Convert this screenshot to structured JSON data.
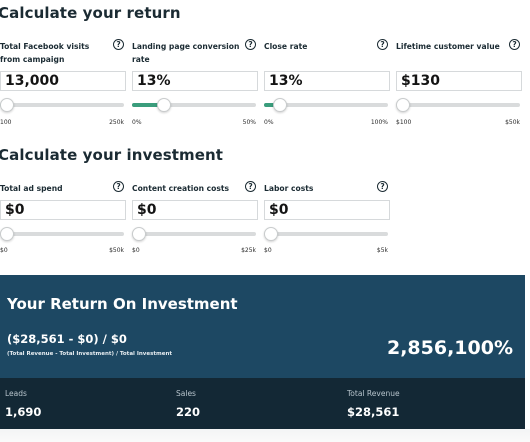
{
  "return_section": {
    "title": "Calculate your return",
    "fields": [
      {
        "label": "Total Facebook visits from campaign",
        "value": "13,000",
        "min": "100",
        "max": "250k",
        "level": 0.05
      },
      {
        "label": "Landing page conversion rate",
        "value": "13%",
        "min": "0%",
        "max": "50%",
        "level": 0.26
      },
      {
        "label": "Close rate",
        "value": "13%",
        "min": "0%",
        "max": "100%",
        "level": 0.13
      },
      {
        "label": "Lifetime customer value",
        "value": "$130",
        "min": "$100",
        "max": "$50k",
        "level": 0.0
      }
    ]
  },
  "investment_section": {
    "title": "Calculate your investment",
    "fields": [
      {
        "label": "Total ad spend",
        "value": "$0",
        "min": "$0",
        "max": "$50k",
        "level": 0.0
      },
      {
        "label": "Content creation costs",
        "value": "$0",
        "min": "$0",
        "max": "$25k",
        "level": 0.0
      },
      {
        "label": "Labor costs",
        "value": "$0",
        "min": "$0",
        "max": "$5k",
        "level": 0.0
      }
    ]
  },
  "help_glyph": "?",
  "roi": {
    "title": "Your Return On Investment",
    "formula": "($28,561 - $0) / $0",
    "caption": "(Total Revenue - Total Investment) / Total Investment",
    "result": "2,856,100%"
  },
  "stats": [
    {
      "label": "Leads",
      "value": "1,690"
    },
    {
      "label": "Sales",
      "value": "220"
    },
    {
      "label": "Total Revenue",
      "value": "$28,561"
    }
  ],
  "colors": {
    "slider_fill": "#3a9d7c",
    "roi_panel": "#1d4863",
    "stats_panel": "#132835",
    "heading": "#1b2b33"
  },
  "icons": {
    "help": "question-circle-icon"
  }
}
